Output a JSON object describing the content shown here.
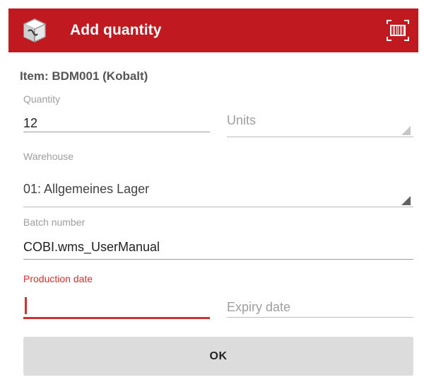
{
  "appbar": {
    "title": "Add quantity",
    "icon": "box-icon",
    "action_icon": "barcode-scanner-icon",
    "color": "#c0191f"
  },
  "form": {
    "item_label": "Item: BDM001 (Kobalt)",
    "quantity": {
      "label": "Quantity",
      "value": "12"
    },
    "unit": {
      "value": "Units"
    },
    "warehouse": {
      "label": "Warehouse",
      "value": "01: Allgemeines Lager"
    },
    "batch": {
      "label": "Batch number",
      "value": "COBI.wms_UserManual"
    },
    "production_date": {
      "label": "Production date",
      "value": ""
    },
    "expiry_date": {
      "placeholder": "Expiry date"
    }
  },
  "ok_button": {
    "label": "OK"
  },
  "colors": {
    "accent": "#d32f2f",
    "button": "#dcdcdc"
  }
}
